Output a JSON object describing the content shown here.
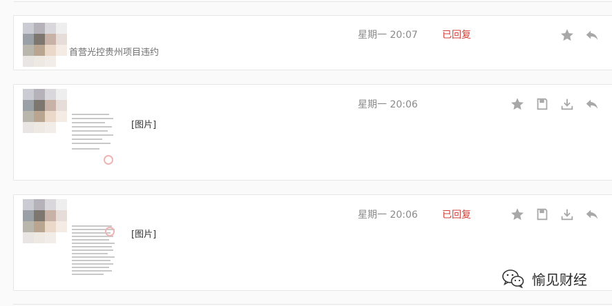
{
  "colors": {
    "status_red": "#d2403a",
    "time_gray": "#8a8a8a",
    "icon_gray": "#a8a8a8"
  },
  "messages": [
    {
      "time": "星期一 20:07",
      "status": "已回复",
      "snippet": "首营光控贵州项目违约",
      "icons": [
        "star-icon",
        "reply-icon"
      ]
    },
    {
      "time": "星期一 20:06",
      "status": "",
      "image_label": "[图片]",
      "icons": [
        "star-icon",
        "save-icon",
        "download-icon",
        "reply-icon"
      ]
    },
    {
      "time": "星期一 20:06",
      "status": "已回复",
      "image_label": "[图片]",
      "icons": [
        "star-icon",
        "save-icon",
        "download-icon",
        "reply-icon"
      ]
    }
  ],
  "watermark": {
    "text": "愉见财经",
    "icon": "wechat-logo-icon"
  }
}
